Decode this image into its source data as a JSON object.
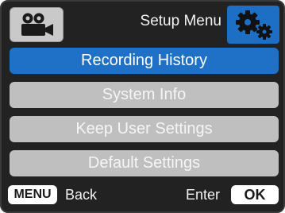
{
  "header": {
    "mode_icon": "video-camera-icon",
    "title": "Setup Menu",
    "settings_icon": "gears-icon"
  },
  "menu": {
    "items": [
      {
        "label": "Recording History",
        "selected": true
      },
      {
        "label": "System Info",
        "selected": false
      },
      {
        "label": "Keep User Settings",
        "selected": false
      },
      {
        "label": "Default Settings",
        "selected": false
      }
    ]
  },
  "footer": {
    "menu_key": "MENU",
    "back_label": "Back",
    "enter_label": "Enter",
    "ok_key": "OK"
  },
  "colors": {
    "accent": "#1f71c7",
    "item_bg": "#bfbfbf",
    "screen_bg": "#222222"
  }
}
